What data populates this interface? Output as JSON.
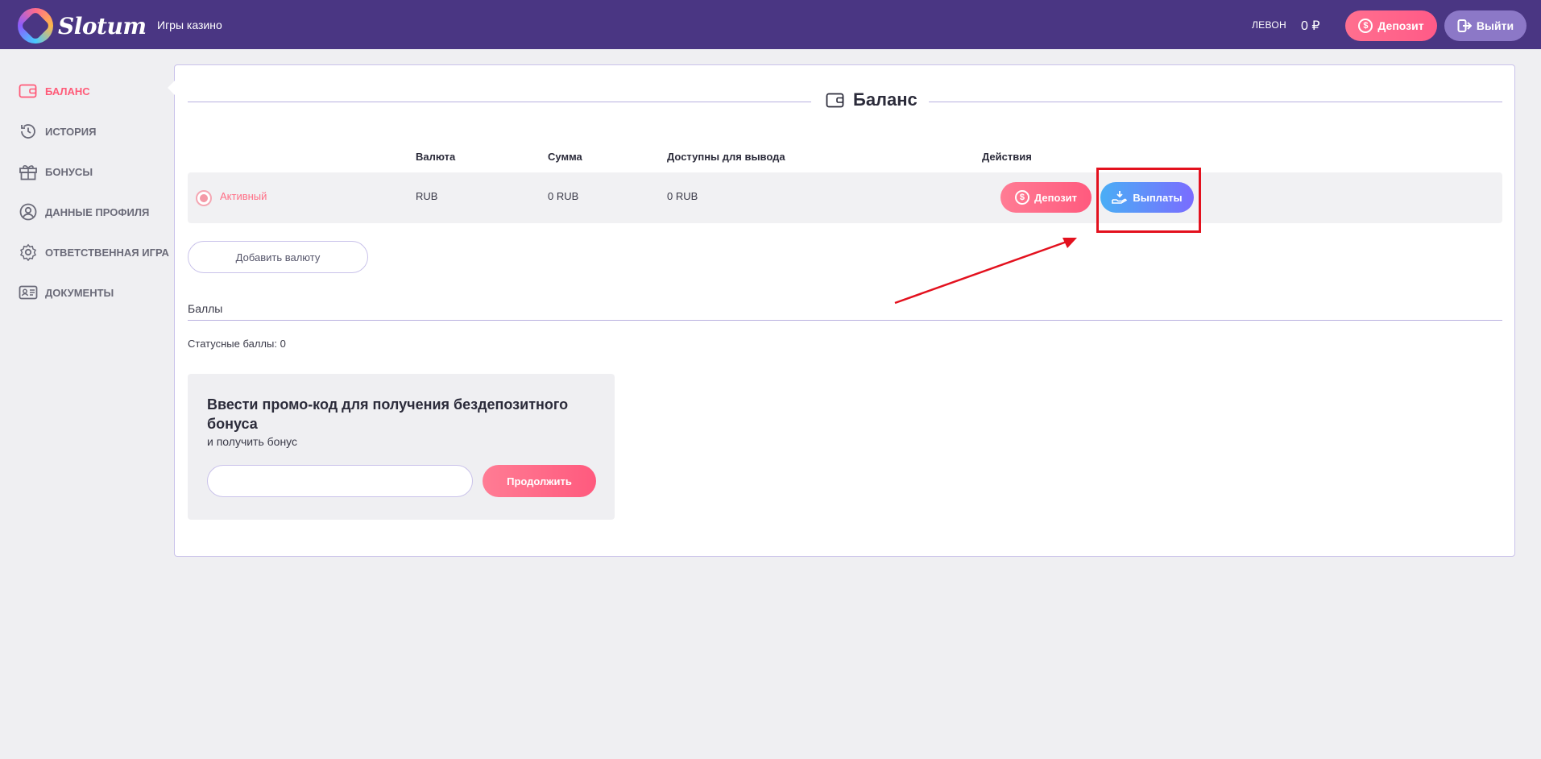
{
  "header": {
    "logo_text": "Slotum",
    "nav_casino": "Игры казино",
    "user_name": "ЛЕВОН",
    "balance": "0 ₽",
    "deposit_label": "Депозит",
    "logout_label": "Выйти"
  },
  "sidebar": {
    "items": [
      {
        "label": "БАЛАНС",
        "icon": "wallet-icon",
        "active": true
      },
      {
        "label": "ИСТОРИЯ",
        "icon": "history-icon"
      },
      {
        "label": "БОНУСЫ",
        "icon": "gift-icon"
      },
      {
        "label": "ДАННЫЕ ПРОФИЛЯ",
        "icon": "user-icon"
      },
      {
        "label": "ОТВЕТСТВЕННАЯ ИГРА",
        "icon": "gear-icon"
      },
      {
        "label": "ДОКУМЕНТЫ",
        "icon": "id-card-icon"
      }
    ]
  },
  "main": {
    "title": "Баланс",
    "table": {
      "headers": {
        "currency": "Валюта",
        "sum": "Сумма",
        "available": "Доступны для вывода",
        "actions": "Действия"
      },
      "row": {
        "status": "Активный",
        "currency": "RUB",
        "sum": "0 RUB",
        "available": "0 RUB"
      },
      "deposit_label": "Депозит",
      "payout_label": "Выплаты"
    },
    "add_currency_label": "Добавить валюту",
    "points_title": "Баллы",
    "status_points": "Статусные баллы: 0",
    "promo": {
      "title": "Ввести промо-код для получения бездепозитного бонуса",
      "subtitle": "и получить бонус",
      "input_value": "",
      "continue_label": "Продолжить"
    }
  },
  "colors": {
    "header_bg": "#4a3683",
    "accent_pink": "#ff5a7e",
    "accent_blue": "#4aaef5",
    "highlight_red": "#e3111e"
  }
}
